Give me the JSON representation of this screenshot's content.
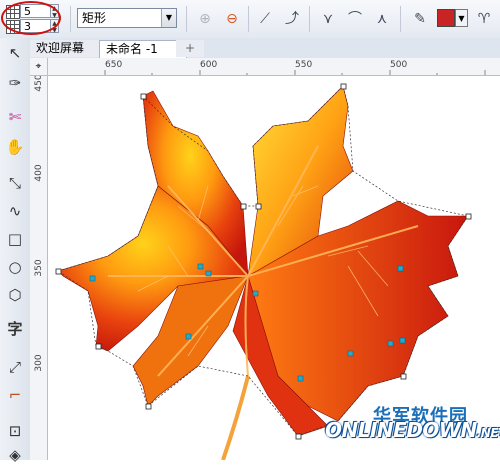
{
  "propbar": {
    "rows_value": "5",
    "cols_value": "3",
    "shape_select": "矩形",
    "accent_color": "#c82424",
    "tools": [
      "add-node-icon",
      "delete-node-icon",
      "line-segment-icon",
      "curve-icon",
      "cusp-node-icon",
      "smooth-node-icon",
      "symmetric-node-icon",
      "eyedropper-icon",
      "goblet-icon"
    ]
  },
  "tabs": {
    "welcome": "欢迎屏幕",
    "document": "未命名 -1",
    "add": "+"
  },
  "rulers": {
    "horizontal": [
      "650",
      "600",
      "550",
      "500"
    ],
    "vertical": [
      "400",
      "350",
      "300"
    ],
    "corner_top": "450"
  },
  "toolbox": [
    "pointer-icon",
    "shape-tool-icon",
    "crop-icon",
    "pan-icon",
    "freehand-icon",
    "artistic-media-icon",
    "rectangle-icon",
    "ellipse-icon",
    "polygon-icon",
    "text-icon",
    "dimension-icon",
    "connector-icon",
    "effects-icon",
    "fill-icon"
  ],
  "watermark": {
    "cn": "华军软件园",
    "en": "ONLINEDOWN",
    "en_suffix": ".NET"
  }
}
